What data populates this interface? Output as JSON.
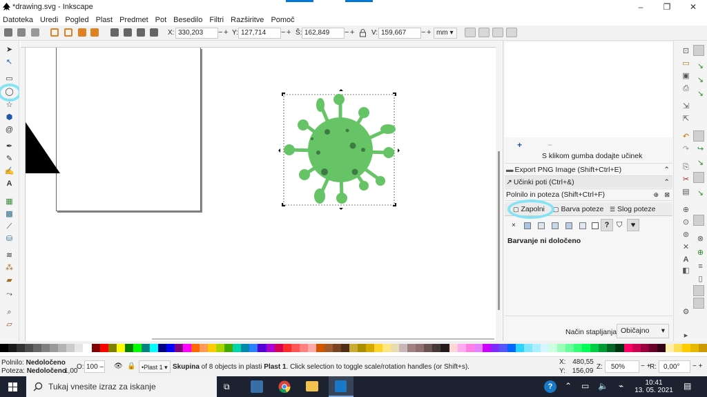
{
  "window": {
    "title": "*drawing.svg - Inkscape",
    "minimize": "–",
    "maximize": "❐",
    "close": "✕"
  },
  "menu": [
    "Datoteka",
    "Uredi",
    "Pogled",
    "Plast",
    "Predmet",
    "Pot",
    "Besedilo",
    "Filtri",
    "Razširitve",
    "Pomoč"
  ],
  "toolbar": {
    "x_label": "X:",
    "x_value": "330,203",
    "y_label": "Y:",
    "y_value": "127,714",
    "w_label": "Š:",
    "w_value": "162,849",
    "h_label": "V:",
    "h_value": "159,667",
    "unit": "mm",
    "minus": "−",
    "plus": "+"
  },
  "panel": {
    "effect_hint": "S klikom gumba dodajte učinek",
    "export_png": "Export PNG Image (Shift+Ctrl+E)",
    "path_effects": "Učinki poti  (Ctrl+&)",
    "fill_stroke": "Polnilo in poteza  (Shift+Ctrl+F)",
    "tabs": [
      "Zapolni",
      "Barva poteze",
      "Slog poteze"
    ],
    "fill_status": "Barvanje ni določeno",
    "blend_label": "Način stapljanja:",
    "blend_value": "Običajno",
    "paint_x": "×",
    "paint_unknown": "?"
  },
  "status": {
    "fill_label": "Polnilo:",
    "fill_value": "Nedoločeno",
    "stroke_label": "Poteza:",
    "stroke_value": "Nedoločeno",
    "stroke_width": "1,00",
    "opacity_label": "O:",
    "opacity_value": "100",
    "layer": "•Plast 1",
    "message_bold": "Skupina",
    "message_rest": " of 8 objects in plasti ",
    "message_layer": "Plast 1",
    "message_tail": ". Click selection to toggle scale/rotation handles (or Shift+s).",
    "cx_label": "X:",
    "cx_value": "480,55",
    "cy_label": "Y:",
    "cy_value": "156,09",
    "zoom_label": "Z:",
    "zoom_value": "50%",
    "rot_label": "R:",
    "rot_value": "0,00°"
  },
  "taskbar": {
    "search_placeholder": "Tukaj vnesite izraz za iskanje",
    "time": "10:41",
    "date": "13. 05. 2021"
  },
  "colors": {
    "virus": "#66c466",
    "virus_dots": "#3e7a44",
    "highlight": "#86e3f3",
    "taskbar": "#1c2230"
  },
  "palette": [
    "#000000",
    "#1a1a1a",
    "#333333",
    "#4d4d4d",
    "#666666",
    "#808080",
    "#999999",
    "#b3b3b3",
    "#cccccc",
    "#e6e6e6",
    "#ffffff",
    "#800000",
    "#ff0000",
    "#808000",
    "#ffff00",
    "#008000",
    "#00ff00",
    "#008080",
    "#00ffff",
    "#000080",
    "#0000ff",
    "#800080",
    "#ff00ff",
    "#ff6600",
    "#ff9955",
    "#ffcc00",
    "#aad400",
    "#44aa00",
    "#00d4aa",
    "#0088aa",
    "#2a7fff",
    "#5500d4",
    "#aa00d4",
    "#d40055",
    "#ff2a2a",
    "#ff5555",
    "#ff8080",
    "#ffaaaa",
    "#d45500",
    "#a05a2c",
    "#784421",
    "#502d16",
    "#c8ab37",
    "#ab8f00",
    "#d4aa00",
    "#ffd42a",
    "#ffe680",
    "#e9ddaf",
    "#c8b7b7",
    "#a08080",
    "#916f6f",
    "#6c5353",
    "#483737",
    "#241c1c",
    "#ffd5d5",
    "#ffaaee",
    "#ff80e5",
    "#e580ff",
    "#cc00ff",
    "#7f2aff",
    "#5555ff",
    "#0066ff",
    "#2ad4ff",
    "#80e5ff",
    "#aaeeff",
    "#d5f6ff",
    "#ccffdd",
    "#99ffbb",
    "#66ff99",
    "#33ff77",
    "#00ff55",
    "#00cc44",
    "#009933",
    "#006622",
    "#003311",
    "#ff0066",
    "#cc0052",
    "#99003d",
    "#660029",
    "#330014",
    "#ffeeaa",
    "#ffdd55",
    "#ffcc00",
    "#e6b800",
    "#cc9900"
  ]
}
